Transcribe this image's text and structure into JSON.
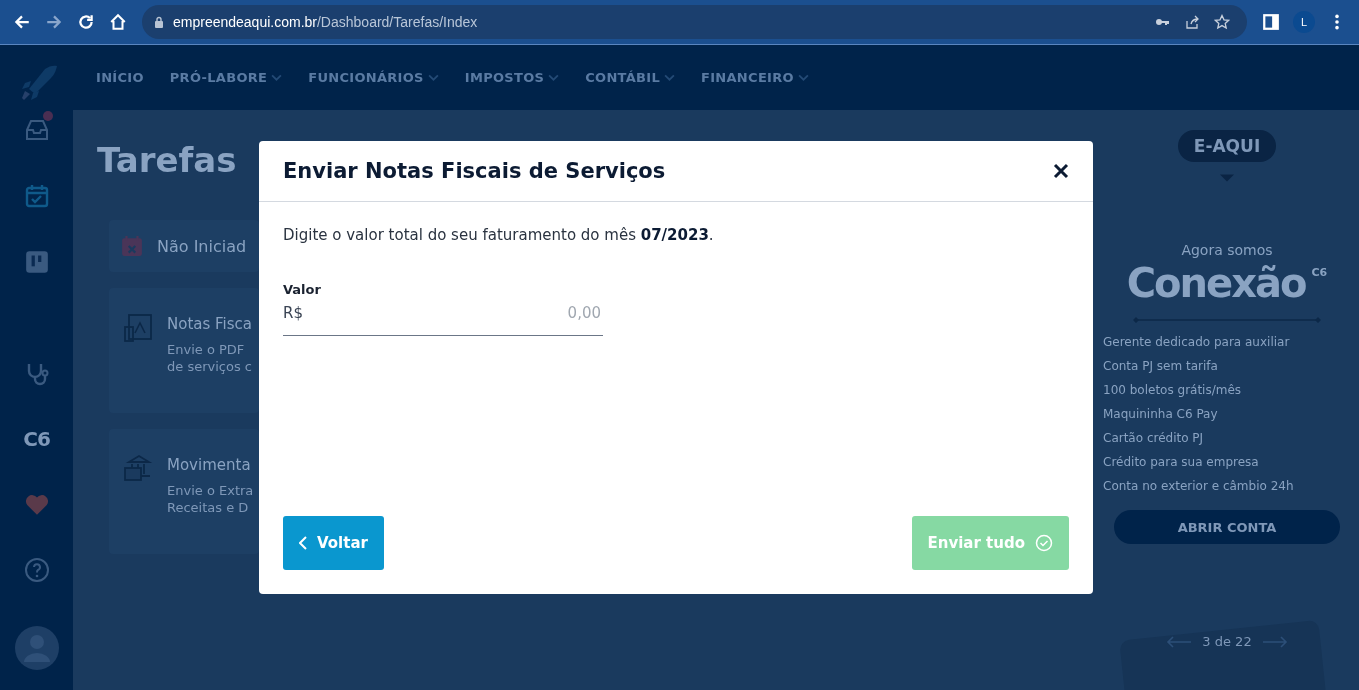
{
  "browser": {
    "url_host": "empreendeaqui.com.br",
    "url_path": "/Dashboard/Tarefas/Index",
    "profile_initial": "L"
  },
  "nav": [
    {
      "label": "INÍCIO",
      "dropdown": false
    },
    {
      "label": "PRÓ-LABORE",
      "dropdown": true
    },
    {
      "label": "FUNCIONÁRIOS",
      "dropdown": true
    },
    {
      "label": "IMPOSTOS",
      "dropdown": true
    },
    {
      "label": "CONTÁBIL",
      "dropdown": true
    },
    {
      "label": "FINANCEIRO",
      "dropdown": true
    }
  ],
  "sidebar": {
    "logo_text": "C6",
    "inbox_unread": true
  },
  "page": {
    "title": "Tarefas",
    "status_label": "Não Iniciad",
    "tasks": [
      {
        "kind": "pdf",
        "title": "Notas Fisca",
        "lines": [
          "Envie o PDF",
          "de serviços c"
        ]
      },
      {
        "kind": "bank",
        "title": "Movimenta",
        "lines": [
          "Envie o Extra",
          "Receitas e D"
        ]
      }
    ]
  },
  "promo": {
    "badge": "E-AQUI",
    "intro": "Agora somos",
    "brand": "Conexão",
    "brand_mark": "C6",
    "benefits": [
      "Gerente dedicado para auxiliar",
      "Conta PJ sem tarifa",
      "100 boletos grátis/mês",
      "Maquininha C6 Pay",
      "Cartão crédito PJ",
      "Crédito para sua empresa",
      "Conta no exterior e câmbio 24h"
    ],
    "button": "ABRIR CONTA",
    "pager": "3 de 22"
  },
  "modal": {
    "title": "Enviar Notas Fiscais de Serviços",
    "message": "Digite o valor total do seu faturamento do mês **07/2023**.",
    "field": {
      "label": "Valor",
      "prefix": "R$",
      "placeholder": "0,00"
    },
    "back_button": "Voltar",
    "submit_button": {
      "label": "Enviar tudo",
      "disabled": true
    }
  }
}
